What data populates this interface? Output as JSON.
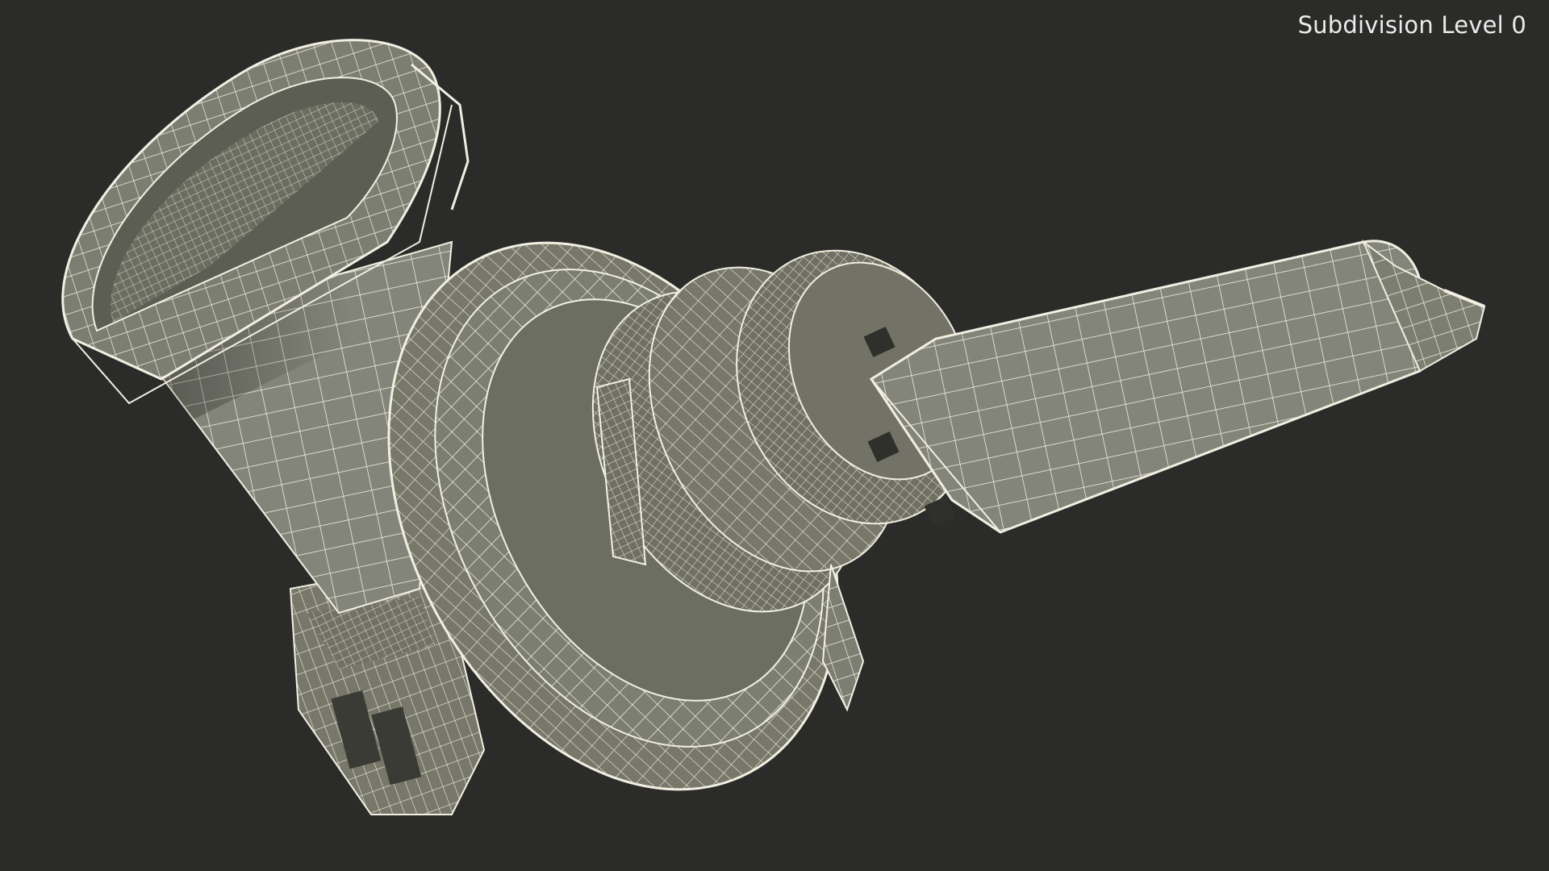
{
  "viewport": {
    "background": "#2b2b29",
    "overlay_label": "Subdivision Level 0"
  },
  "model": {
    "description_icon": "wireframe-halogen-bulb-model",
    "surface_color": "#7f8074",
    "wire_color": "#f3f1e4"
  }
}
